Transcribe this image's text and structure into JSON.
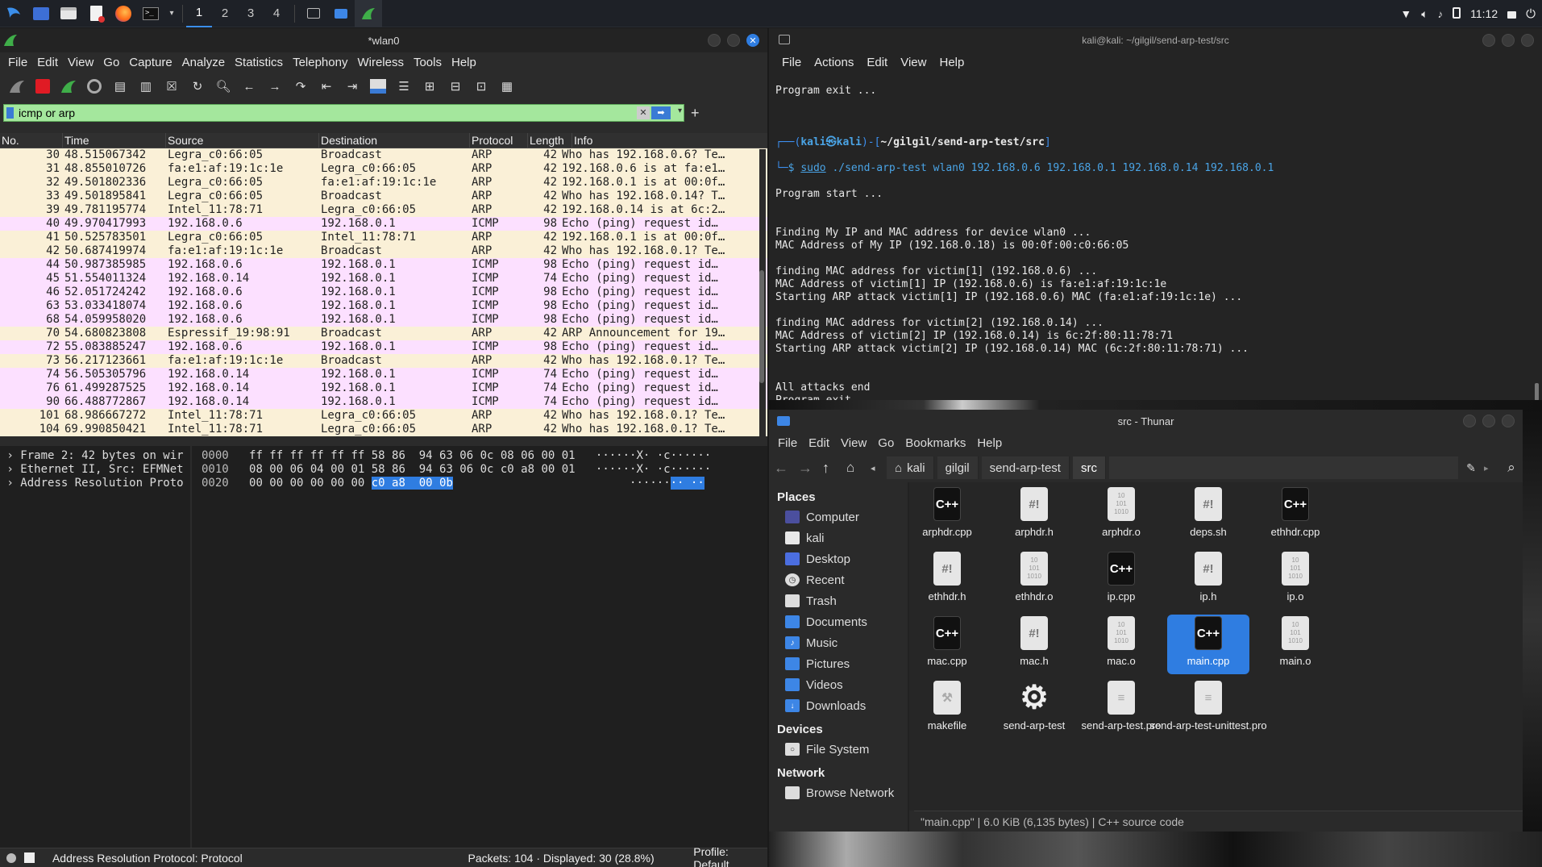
{
  "taskbar": {
    "workspaces": [
      "1",
      "2",
      "3",
      "4"
    ],
    "active_workspace": "1",
    "clock": "11:12"
  },
  "wireshark": {
    "title": "*wlan0",
    "menu": [
      "File",
      "Edit",
      "View",
      "Go",
      "Capture",
      "Analyze",
      "Statistics",
      "Telephony",
      "Wireless",
      "Tools",
      "Help"
    ],
    "filter": "icmp or arp",
    "columns": [
      "No.",
      "Time",
      "Source",
      "Destination",
      "Protocol",
      "Length",
      "Info"
    ],
    "packets": [
      {
        "no": "30",
        "time": "48.515067342",
        "src": "Legra_c0:66:05",
        "dst": "Broadcast",
        "proto": "ARP",
        "len": "42",
        "info": "Who has 192.168.0.6? Te…"
      },
      {
        "no": "31",
        "time": "48.855010726",
        "src": "fa:e1:af:19:1c:1e",
        "dst": "Legra_c0:66:05",
        "proto": "ARP",
        "len": "42",
        "info": "192.168.0.6 is at fa:e1…"
      },
      {
        "no": "32",
        "time": "49.501802336",
        "src": "Legra_c0:66:05",
        "dst": "fa:e1:af:19:1c:1e",
        "proto": "ARP",
        "len": "42",
        "info": "192.168.0.1 is at 00:0f…"
      },
      {
        "no": "33",
        "time": "49.501895841",
        "src": "Legra_c0:66:05",
        "dst": "Broadcast",
        "proto": "ARP",
        "len": "42",
        "info": "Who has 192.168.0.14? T…"
      },
      {
        "no": "39",
        "time": "49.781195774",
        "src": "Intel_11:78:71",
        "dst": "Legra_c0:66:05",
        "proto": "ARP",
        "len": "42",
        "info": "192.168.0.14 is at 6c:2…"
      },
      {
        "no": "40",
        "time": "49.970417993",
        "src": "192.168.0.6",
        "dst": "192.168.0.1",
        "proto": "ICMP",
        "len": "98",
        "info": "Echo (ping) request  id…"
      },
      {
        "no": "41",
        "time": "50.525783501",
        "src": "Legra_c0:66:05",
        "dst": "Intel_11:78:71",
        "proto": "ARP",
        "len": "42",
        "info": "192.168.0.1 is at 00:0f…"
      },
      {
        "no": "42",
        "time": "50.687419974",
        "src": "fa:e1:af:19:1c:1e",
        "dst": "Broadcast",
        "proto": "ARP",
        "len": "42",
        "info": "Who has 192.168.0.1? Te…"
      },
      {
        "no": "44",
        "time": "50.987385985",
        "src": "192.168.0.6",
        "dst": "192.168.0.1",
        "proto": "ICMP",
        "len": "98",
        "info": "Echo (ping) request  id…"
      },
      {
        "no": "45",
        "time": "51.554011324",
        "src": "192.168.0.14",
        "dst": "192.168.0.1",
        "proto": "ICMP",
        "len": "74",
        "info": "Echo (ping) request  id…"
      },
      {
        "no": "46",
        "time": "52.051724242",
        "src": "192.168.0.6",
        "dst": "192.168.0.1",
        "proto": "ICMP",
        "len": "98",
        "info": "Echo (ping) request  id…"
      },
      {
        "no": "63",
        "time": "53.033418074",
        "src": "192.168.0.6",
        "dst": "192.168.0.1",
        "proto": "ICMP",
        "len": "98",
        "info": "Echo (ping) request  id…"
      },
      {
        "no": "68",
        "time": "54.059958020",
        "src": "192.168.0.6",
        "dst": "192.168.0.1",
        "proto": "ICMP",
        "len": "98",
        "info": "Echo (ping) request  id…"
      },
      {
        "no": "70",
        "time": "54.680823808",
        "src": "Espressif_19:98:91",
        "dst": "Broadcast",
        "proto": "ARP",
        "len": "42",
        "info": "ARP Announcement for 19…"
      },
      {
        "no": "72",
        "time": "55.083885247",
        "src": "192.168.0.6",
        "dst": "192.168.0.1",
        "proto": "ICMP",
        "len": "98",
        "info": "Echo (ping) request  id…"
      },
      {
        "no": "73",
        "time": "56.217123661",
        "src": "fa:e1:af:19:1c:1e",
        "dst": "Broadcast",
        "proto": "ARP",
        "len": "42",
        "info": "Who has 192.168.0.1? Te…"
      },
      {
        "no": "74",
        "time": "56.505305796",
        "src": "192.168.0.14",
        "dst": "192.168.0.1",
        "proto": "ICMP",
        "len": "74",
        "info": "Echo (ping) request  id…"
      },
      {
        "no": "76",
        "time": "61.499287525",
        "src": "192.168.0.14",
        "dst": "192.168.0.1",
        "proto": "ICMP",
        "len": "74",
        "info": "Echo (ping) request  id…"
      },
      {
        "no": "90",
        "time": "66.488772867",
        "src": "192.168.0.14",
        "dst": "192.168.0.1",
        "proto": "ICMP",
        "len": "74",
        "info": "Echo (ping) request  id…"
      },
      {
        "no": "101",
        "time": "68.986667272",
        "src": "Intel_11:78:71",
        "dst": "Legra_c0:66:05",
        "proto": "ARP",
        "len": "42",
        "info": "Who has 192.168.0.1? Te…"
      },
      {
        "no": "104",
        "time": "69.990850421",
        "src": "Intel_11:78:71",
        "dst": "Legra_c0:66:05",
        "proto": "ARP",
        "len": "42",
        "info": "Who has 192.168.0.1? Te…"
      }
    ],
    "details": [
      "Frame 2: 42 bytes on wir",
      "Ethernet II, Src: EFMNet",
      "Address Resolution Proto"
    ],
    "hex": [
      {
        "offset": "0000",
        "bytes": "ff ff ff ff ff ff 58 86  94 63 06 0c 08 06 00 01",
        "ascii": "······X· ·c······"
      },
      {
        "offset": "0010",
        "bytes": "08 00 06 04 00 01 58 86  94 63 06 0c c0 a8 00 01",
        "ascii": "······X· ·c······"
      },
      {
        "offset": "0020",
        "bytes_pre": "00 00 00 00 00 00 ",
        "bytes_hl": "c0 a8  00 0b",
        "ascii_pre": "······",
        "ascii_hl": "·· ··"
      }
    ],
    "status": {
      "field": "Address Resolution Protocol: Protocol",
      "packets": "Packets: 104 · Displayed: 30 (28.8%)",
      "profile": "Profile: Default"
    }
  },
  "terminal": {
    "title": "kali@kali: ~/gilgil/send-arp-test/src",
    "menu": [
      "File",
      "Actions",
      "Edit",
      "View",
      "Help"
    ],
    "prompt_user": "kali㉿kali",
    "prompt_dir": "~/gilgil/send-arp-test/src",
    "cmd_sudo": "sudo",
    "cmd_rest": " ./send-arp-test wlan0 192.168.0.6 192.168.0.1 192.168.0.14 192.168.0.1",
    "lines_top": [
      "Program exit ..."
    ],
    "lines_mid": [
      "Program start ...",
      "",
      "",
      "Finding My IP and MAC address for device wlan0 ...",
      "MAC Address of My IP (192.168.0.18) is 00:0f:00:c0:66:05",
      "",
      "finding MAC address for victim[1] (192.168.0.6) ...",
      "MAC Address of victim[1] IP (192.168.0.6) is fa:e1:af:19:1c:1e",
      "Starting ARP attack victim[1] IP (192.168.0.6) MAC (fa:e1:af:19:1c:1e) ...",
      "",
      "finding MAC address for victim[2] (192.168.0.14) ...",
      "MAC Address of victim[2] IP (192.168.0.14) is 6c:2f:80:11:78:71",
      "Starting ARP attack victim[2] IP (192.168.0.14) MAC (6c:2f:80:11:78:71) ...",
      "",
      "",
      "All attacks end",
      "Program exit ..."
    ]
  },
  "thunar": {
    "title": "src - Thunar",
    "menu": [
      "File",
      "Edit",
      "View",
      "Go",
      "Bookmarks",
      "Help"
    ],
    "path": [
      "kali",
      "gilgil",
      "send-arp-test",
      "src"
    ],
    "places_header": "Places",
    "places": [
      "Computer",
      "kali",
      "Desktop",
      "Recent",
      "Trash",
      "Documents",
      "Music",
      "Pictures",
      "Videos",
      "Downloads"
    ],
    "devices_header": "Devices",
    "devices": [
      "File System"
    ],
    "network_header": "Network",
    "network": [
      "Browse Network"
    ],
    "files": [
      {
        "name": "arphdr.cpp",
        "type": "cpp"
      },
      {
        "name": "arphdr.h",
        "type": "sh"
      },
      {
        "name": "arphdr.o",
        "type": "obj"
      },
      {
        "name": "deps.sh",
        "type": "sh"
      },
      {
        "name": "ethhdr.cpp",
        "type": "cpp"
      },
      {
        "name": "ethhdr.h",
        "type": "sh"
      },
      {
        "name": "ethhdr.o",
        "type": "obj"
      },
      {
        "name": "ip.cpp",
        "type": "cpp"
      },
      {
        "name": "ip.h",
        "type": "sh"
      },
      {
        "name": "ip.o",
        "type": "obj"
      },
      {
        "name": "mac.cpp",
        "type": "cpp"
      },
      {
        "name": "mac.h",
        "type": "sh"
      },
      {
        "name": "mac.o",
        "type": "obj"
      },
      {
        "name": "main.cpp",
        "type": "cpp",
        "selected": true
      },
      {
        "name": "main.o",
        "type": "obj"
      },
      {
        "name": "makefile",
        "type": "make"
      },
      {
        "name": "send-arp-test",
        "type": "exec"
      },
      {
        "name": "send-arp-test.pro",
        "type": "doc"
      },
      {
        "name": "send-arp-test-unittest.pro",
        "type": "doc"
      }
    ],
    "status": "\"main.cpp\" | 6.0 KiB (6,135 bytes) | C++ source code"
  }
}
